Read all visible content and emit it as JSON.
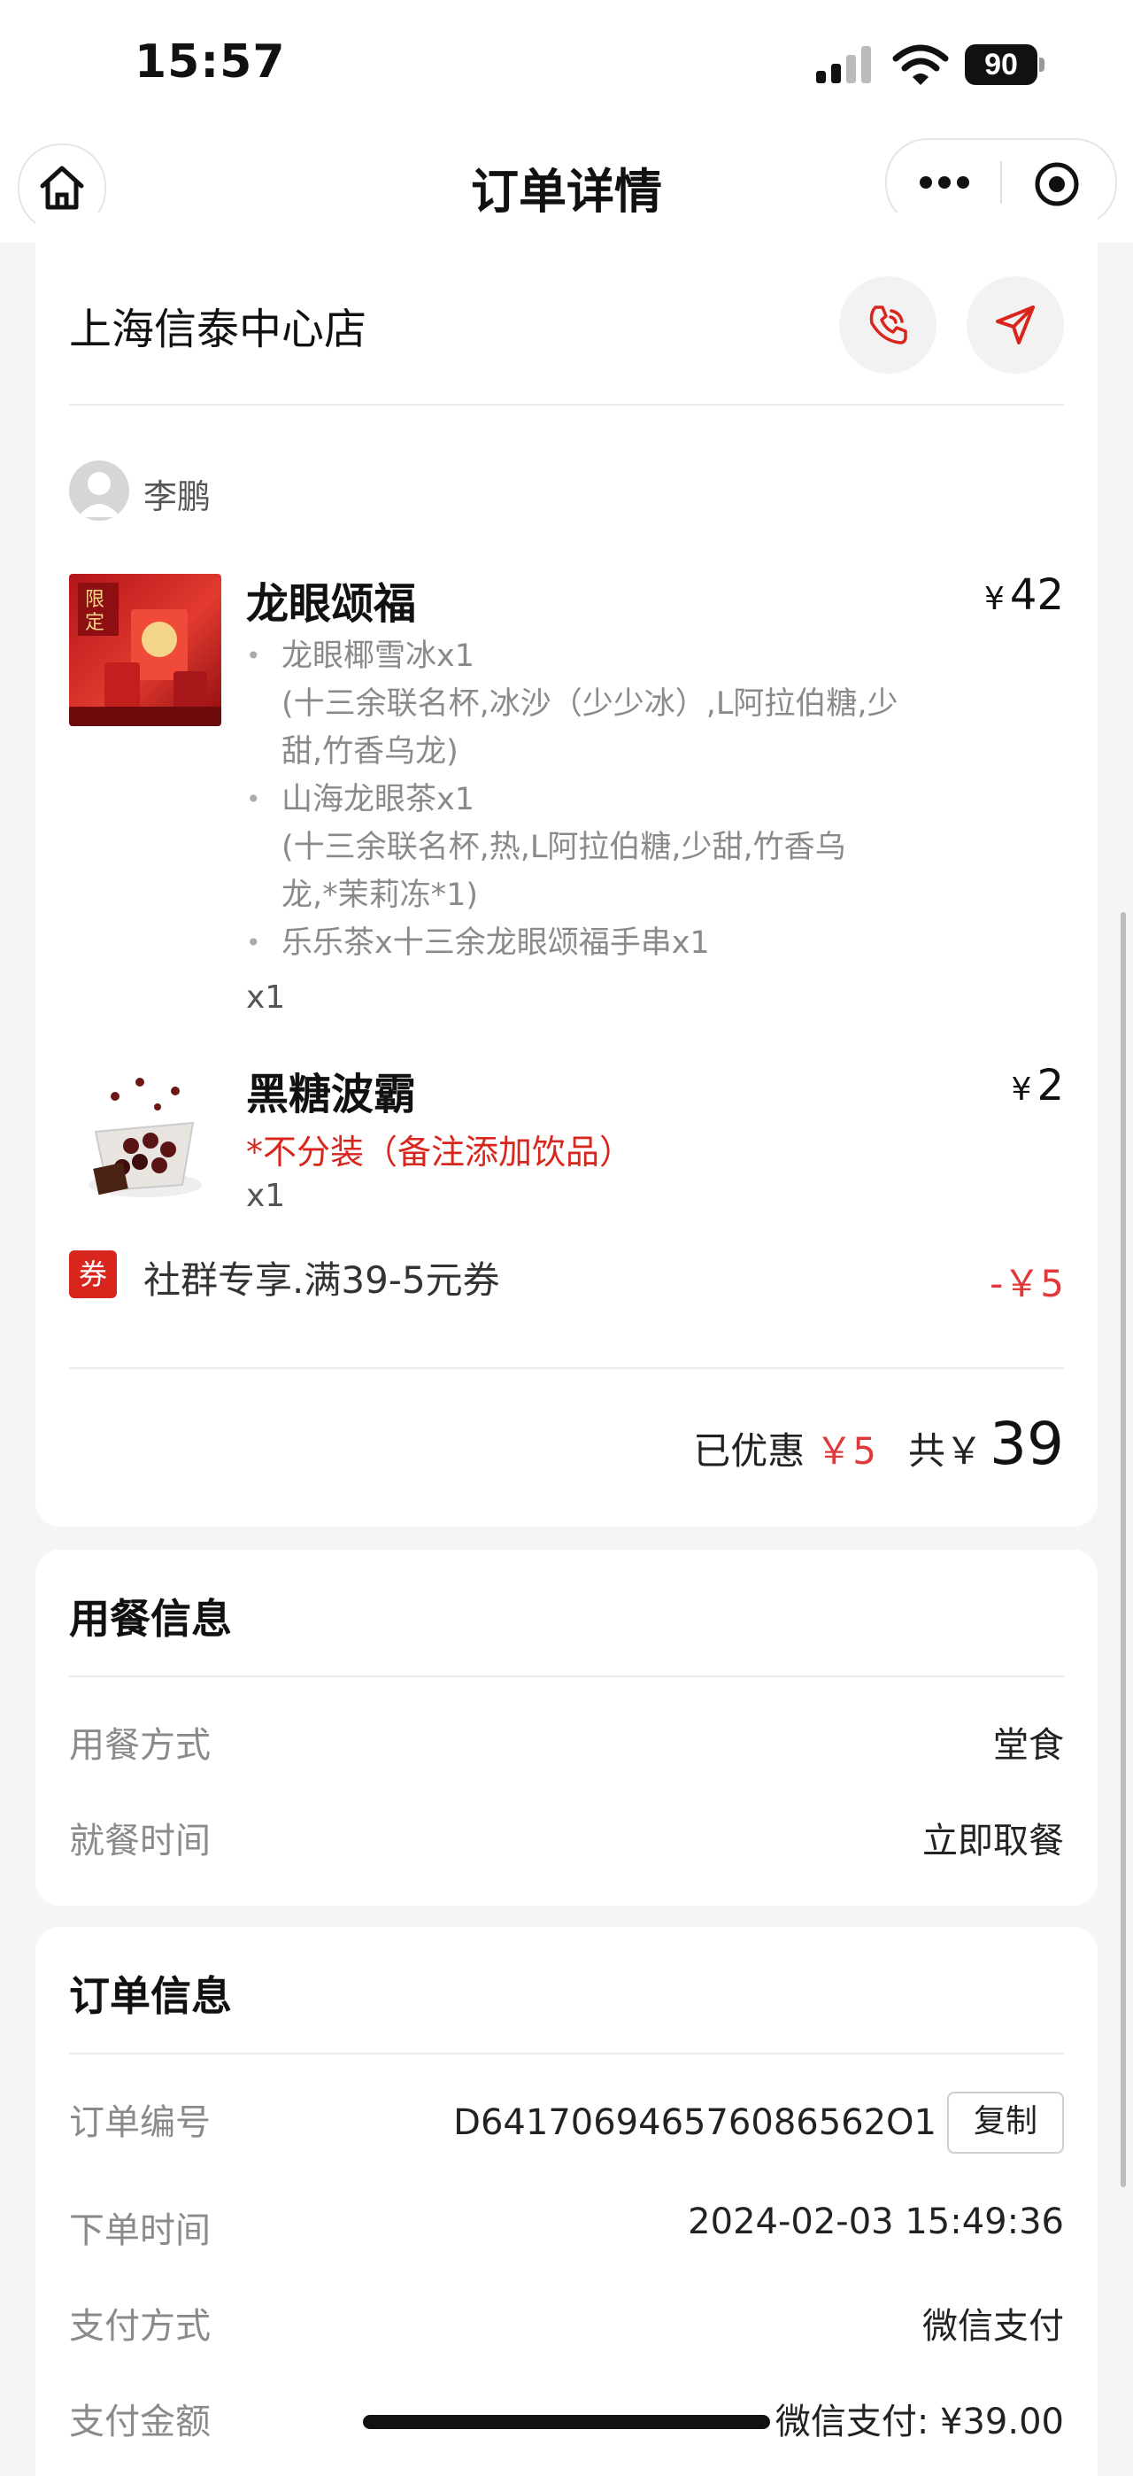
{
  "status_bar": {
    "time": "15:57",
    "battery": "90"
  },
  "nav": {
    "title": "订单详情"
  },
  "store": {
    "name": "上海信泰中心店"
  },
  "customer": {
    "name": "李鹏"
  },
  "items": [
    {
      "name": "龙眼颂福",
      "price": "42",
      "currency": "¥",
      "sub_items": [
        {
          "name": "龙眼椰雪冰x1",
          "detail": "(十三余联名杯,冰沙（少少冰）,L阿拉伯糖,少甜,竹香乌龙)"
        },
        {
          "name": "山海龙眼茶x1",
          "detail": "(十三余联名杯,热,L阿拉伯糖,少甜,竹香乌龙,*茉莉冻*1)"
        },
        {
          "name": "乐乐茶x十三余龙眼颂福手串x1",
          "detail": ""
        }
      ],
      "qty": "x1"
    },
    {
      "name": "黑糖波霸",
      "price": "2",
      "currency": "¥",
      "note": "*不分装（备注添加饮品）",
      "qty": "x1"
    }
  ],
  "coupon": {
    "badge": "券",
    "text": "社群专享.满39-5元券",
    "amount": "-￥5"
  },
  "summary": {
    "discount_label": "已优惠",
    "discount": "￥5",
    "total_label": "共￥",
    "total": "39"
  },
  "meal_info": {
    "title": "用餐信息",
    "rows": [
      {
        "label": "用餐方式",
        "value": "堂食"
      },
      {
        "label": "就餐时间",
        "value": "立即取餐"
      }
    ]
  },
  "order_info": {
    "title": "订单信息",
    "order_no_label": "订单编号",
    "order_no": "D641706946576086562O1",
    "copy_label": "复制",
    "rows": [
      {
        "label": "下单时间",
        "value": "2024-02-03 15:49:36"
      },
      {
        "label": "支付方式",
        "value": "微信支付"
      },
      {
        "label": "支付金额",
        "value": "微信支付: ¥39.00"
      }
    ]
  },
  "colors": {
    "accent_red": "#d9261c",
    "price_red": "#e0393b",
    "background": "#f5f5f5"
  }
}
